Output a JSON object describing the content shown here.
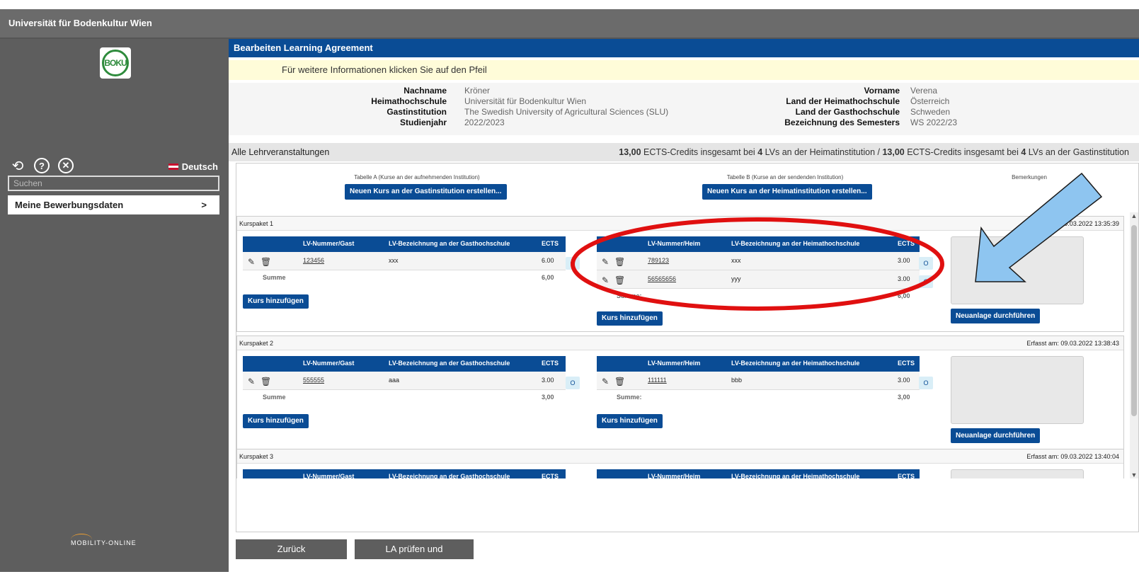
{
  "app": {
    "title": "Universität für Bodenkultur Wien",
    "logo_text": "BOKU"
  },
  "sidebar": {
    "lang": "Deutsch",
    "search_placeholder": "Suchen",
    "menu_item": "Meine Bewerbungsdaten",
    "menu_chevron": ">",
    "footer_logo": "MOBILITY-ONLINE"
  },
  "header": {
    "title": "Bearbeiten Learning Agreement",
    "info": "Für weitere Informationen klicken Sie auf den Pfeil"
  },
  "student": {
    "nachname_label": "Nachname",
    "nachname": "Kröner",
    "heimat_label": "Heimathochschule",
    "heimat": "Universität für Bodenkultur Wien",
    "gast_label": "Gastinstitution",
    "gast": "The Swedish University of Agricultural Sciences (SLU)",
    "jahr_label": "Studienjahr",
    "jahr": "2022/2023",
    "vorname_label": "Vorname",
    "vorname": "Verena",
    "land_heimat_label": "Land der Heimathochschule",
    "land_heimat": "Österreich",
    "land_gast_label": "Land der Gasthochschule",
    "land_gast": "Schweden",
    "semester_label": "Bezeichnung des Semesters",
    "semester": "WS 2022/23"
  },
  "summary": {
    "left": "Alle Lehrveranstaltungen",
    "ects_heim": "13,00",
    "lvs_heim": "4",
    "ects_gast": "13,00",
    "lvs_gast": "4",
    "t1": " ECTS-Credits insgesamt bei ",
    "t2": " LVs an der Heimatinstitution / ",
    "t3": " LVs an der Gastinstitution"
  },
  "columns": {
    "a_head": "Tabelle A (Kurse an der aufnehmenden Institution)",
    "a_btn": "Neuen Kurs an der Gastinstitution erstellen...",
    "b_head": "Tabelle B (Kurse an der sendenden Institution)",
    "b_btn": "Neuen Kurs an der Heimatinstitution erstellen...",
    "remarks": "Bemerkungen"
  },
  "table_heads": {
    "gast_nr": "LV-Nummer/Gast",
    "gast_bez": "LV-Bezeichnung an der Gasthochschule",
    "heim_nr": "LV-Nummer/Heim",
    "heim_bez": "LV-Bezeichnung an der Heimathochschule",
    "ects": "ECTS",
    "summe": "Summe",
    "summe_colon": "Summe:",
    "add": "Kurs hinzufügen",
    "new": "Neuanlage durchführen",
    "o": "O"
  },
  "packages": [
    {
      "title": "Kurspaket 1",
      "erfasst": "Erfasst am: 09.03.2022 13:35:39",
      "gast": [
        {
          "nr": "123456",
          "bez": "xxx",
          "ects": "6.00"
        }
      ],
      "gast_sum": "6,00",
      "heim": [
        {
          "nr": "789123",
          "bez": "xxx",
          "ects": "3.00"
        },
        {
          "nr": "56565656",
          "bez": "yyy",
          "ects": "3.00"
        }
      ],
      "heim_sum": "6,00"
    },
    {
      "title": "Kurspaket 2",
      "erfasst": "Erfasst am: 09.03.2022 13:38:43",
      "gast": [
        {
          "nr": "555555",
          "bez": "aaa",
          "ects": "3.00"
        }
      ],
      "gast_sum": "3,00",
      "heim": [
        {
          "nr": "111111",
          "bez": "bbb",
          "ects": "3.00"
        }
      ],
      "heim_sum": "3,00"
    },
    {
      "title": "Kurspaket 3",
      "erfasst": "Erfasst am: 09.03.2022 13:40:04"
    }
  ],
  "footer": {
    "back": "Zurück",
    "sign": "LA prüfen und unterschreiben"
  },
  "colors": {
    "primary": "#0a4c95",
    "sidebar": "#5e5e5e",
    "annotation_red": "#e01010",
    "annotation_blue": "#8ec5f0"
  }
}
